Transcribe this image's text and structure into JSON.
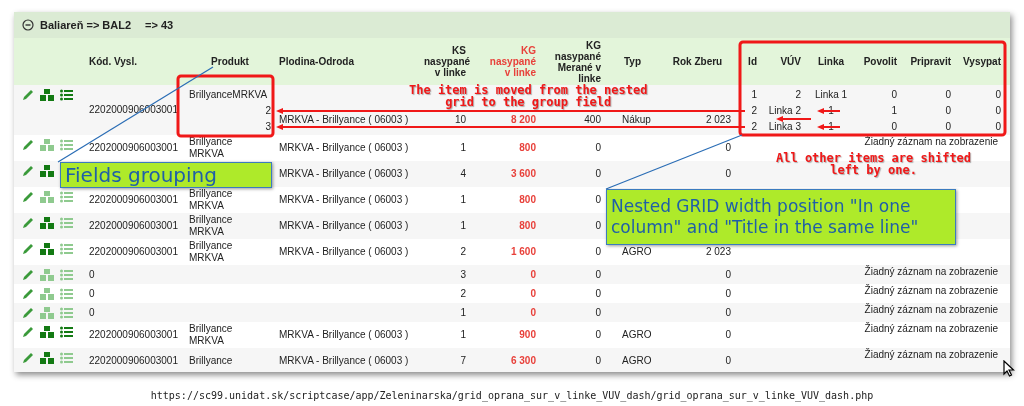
{
  "group_header": {
    "title": "Baliareň => BAL2",
    "count": "=> 43"
  },
  "columns": [
    {
      "label": "Kód. Vysl.",
      "highlight": false
    },
    {
      "label": "Produkt",
      "highlight": false
    },
    {
      "label": "Plodina-Odroda",
      "highlight": false
    },
    {
      "label": "KS\nnasypané\nv linke",
      "highlight": false
    },
    {
      "label": "KG\nnasypané\nv linke",
      "highlight": true
    },
    {
      "label": "KG\nnasypané\nMerané v\nlinke",
      "highlight": false
    },
    {
      "label": "Typ",
      "highlight": false
    },
    {
      "label": "Rok Zberu",
      "highlight": false
    }
  ],
  "nested_columns": [
    "Id",
    "VÚV",
    "Linka",
    "Povolit",
    "Pripravit",
    "Vysypat"
  ],
  "rows": [
    {
      "boxes_active": true,
      "list_active": true,
      "kod": "2202000906003001",
      "produkt": "BrillyanceMRKVA",
      "grouped_values": [
        "2",
        "3"
      ],
      "plodina": "MRKVA - Brillyance ( 06003 )",
      "ks": "10",
      "kg": "8 200",
      "kg_merane": "400",
      "typ": "Nákup",
      "rok": "2 023",
      "nested": [
        [
          "1",
          "2",
          "Linka 1",
          "0",
          "0",
          "0"
        ],
        [
          "2",
          "Linka 2",
          "1",
          "1",
          "0",
          "0"
        ],
        [
          "2",
          "Linka 3",
          "1",
          "0",
          "0",
          "0"
        ]
      ]
    },
    {
      "boxes_active": false,
      "list_active": false,
      "kod": "2202000906003001",
      "produkt": "Brillyance\nMRKVA",
      "plodina": "MRKVA - Brillyance ( 06003 )",
      "ks": "1",
      "kg": "800",
      "kg_merane": "0",
      "rok": "0",
      "nested_empty": "Žiadný záznam na zobrazenie"
    },
    {
      "boxes_active": true,
      "plodina": "MRKVA - Brillyance ( 06003 )",
      "ks": "4",
      "kg": "3 600",
      "kg_merane": "0",
      "rok": "0"
    },
    {
      "boxes_active": false,
      "list_active": false,
      "kod": "2202000906003001",
      "produkt": "Brillyance\nMRKVA",
      "plodina": "MRKVA - Brillyance ( 06003 )",
      "ks": "1",
      "kg": "800",
      "kg_merane": "0"
    },
    {
      "boxes_active": true,
      "list_active": false,
      "kod": "2202000906003001",
      "produkt": "Brillyance\nMRKVA",
      "plodina": "MRKVA - Brillyance ( 06003 )",
      "ks": "1",
      "kg": "800",
      "kg_merane": "0"
    },
    {
      "boxes_active": true,
      "list_active": false,
      "kod": "2202000906003001",
      "produkt": "Brillyance\nMRKVA",
      "plodina": "MRKVA - Brillyance ( 06003 )",
      "ks": "2",
      "kg": "1 600",
      "kg_merane": "0",
      "typ": "AGRO",
      "rok": "2 023"
    },
    {
      "boxes_active": false,
      "list_active": false,
      "kod": "0",
      "ks": "3",
      "kg": "0",
      "kg_merane": "0",
      "rok": "0",
      "nested_empty": "Žiadný záznam na zobrazenie"
    },
    {
      "boxes_active": false,
      "list_active": false,
      "kod": "0",
      "ks": "2",
      "kg": "0",
      "kg_merane": "0",
      "rok": "0",
      "nested_empty": "Žiadný záznam na zobrazenie"
    },
    {
      "boxes_active": false,
      "list_active": false,
      "kod": "0",
      "ks": "1",
      "kg": "0",
      "kg_merane": "0",
      "rok": "0",
      "nested_empty": "Žiadný záznam na zobrazenie"
    },
    {
      "boxes_active": true,
      "list_active": true,
      "kod": "2202000906003001",
      "produkt": "Brillyance\nMRKVA",
      "plodina": "MRKVA - Brillyance ( 06003 )",
      "ks": "1",
      "kg": "900",
      "kg_merane": "0",
      "typ": "AGRO",
      "rok": "0",
      "nested_empty": "Žiadný záznam na zobrazenie"
    },
    {
      "boxes_active": true,
      "list_active": false,
      "kod": "2202000906003001",
      "produkt": "Brillyance",
      "plodina": "MRKVA - Brillyance ( 06003 )",
      "ks": "7",
      "kg": "6 300",
      "kg_merane": "0",
      "typ": "AGRO",
      "rok": "0",
      "nested_empty": "Žiadný záznam na zobrazenie"
    }
  ],
  "annotations": {
    "notes": [
      "The item is moved from the nested\ngrid to the group field",
      "All other items are shifted\nleft by one."
    ],
    "callouts": [
      "Fields grouping",
      "Nested GRID width position \"In one\ncolumn\" and \"Title in the same line\""
    ]
  },
  "url": "https://sc99.unidat.sk/scriptcase/app/Zeleninarska/grid_oprana_sur_v_linke_VUV_dash/grid_oprana_sur_v_linke_VUV_dash.php"
}
